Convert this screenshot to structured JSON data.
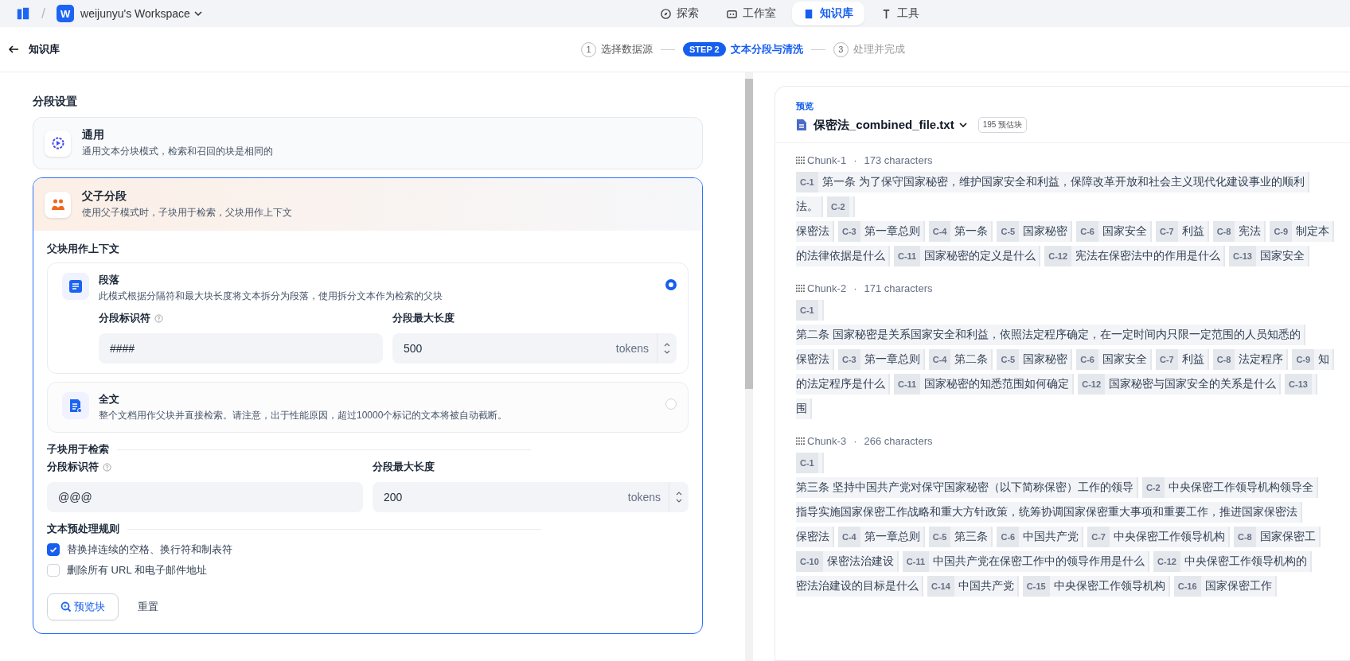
{
  "nav": {
    "separator": "/",
    "workspace": {
      "initial": "W",
      "name": "weijunyu's Workspace"
    },
    "tabs": [
      {
        "label": "探索",
        "kind": "explore",
        "selected": false
      },
      {
        "label": "工作室",
        "kind": "studio",
        "selected": false
      },
      {
        "label": "知识库",
        "kind": "knowledge",
        "selected": true
      },
      {
        "label": "工具",
        "kind": "tools",
        "selected": false
      }
    ]
  },
  "header": {
    "back_label": "知识库",
    "steps": [
      {
        "badge": "1",
        "label": "选择数据源",
        "selected": false
      },
      {
        "badge": "STEP 2",
        "label": "文本分段与清洗",
        "selected": true
      },
      {
        "badge": "3",
        "label": "处理并完成",
        "selected": false
      }
    ]
  },
  "settings": {
    "title": "分段设置",
    "modes": [
      {
        "kind": "general",
        "title": "通用",
        "description": "通用文本分块模式，检索和召回的块是相同的",
        "selected": false
      },
      {
        "kind": "parent_child",
        "title": "父子分段",
        "description": "使用父子模式时，子块用于检索，父块用作上下文",
        "selected": true
      }
    ],
    "parent": {
      "title": "父块用作上下文",
      "options": [
        {
          "kind": "paragraph",
          "title": "段落",
          "description": "此模式根据分隔符和最大块长度将文本拆分为段落，使用拆分文本作为检索的父块",
          "selected": true,
          "fields": [
            {
              "kind": "delimiter",
              "label": "分段标识符",
              "value": "####"
            },
            {
              "kind": "max_length",
              "label": "分段最大长度",
              "value": "500",
              "unit": "tokens"
            }
          ]
        },
        {
          "kind": "fulltext",
          "title": "全文",
          "description": "整个文档用作父块并直接检索。请注意，出于性能原因，超过10000个标记的文本将被自动截断。",
          "selected": false
        }
      ]
    },
    "child": {
      "title": "子块用于检索",
      "fields": [
        {
          "kind": "delimiter",
          "label": "分段标识符",
          "value": "@@@"
        },
        {
          "kind": "max_length",
          "label": "分段最大长度",
          "value": "200",
          "unit": "tokens"
        }
      ]
    },
    "preprocessing": {
      "title": "文本预处理规则",
      "rules": [
        {
          "label": "替换掉连续的空格、换行符和制表符",
          "checked": true
        },
        {
          "label": "删除所有 URL 和电子邮件地址",
          "checked": false
        }
      ]
    },
    "buttons": {
      "preview": "预览块",
      "reset": "重置"
    }
  },
  "preview": {
    "label": "预览",
    "file": "保密法_combined_file.txt",
    "count": "195 预估块",
    "chunks": [
      {
        "title": "Chunk-1",
        "separator": "·",
        "meta": "173 characters",
        "lines": [
          [
            {
              "tag": "C-1",
              "text": "第一条 为了保守国家秘密，维护国家安全和利益，保障改革开放和社会主义现代化建设事业的顺利"
            }
          ],
          [
            {
              "text": "法。"
            },
            {
              "tag": "C-2"
            }
          ],
          [
            {
              "text": "保密法"
            },
            {
              "tag": "C-3",
              "text": "第一章总则"
            },
            {
              "tag": "C-4",
              "text": "第一条"
            },
            {
              "tag": "C-5",
              "text": "国家秘密"
            },
            {
              "tag": "C-6",
              "text": "国家安全"
            },
            {
              "tag": "C-7",
              "text": "利益"
            },
            {
              "tag": "C-8",
              "text": "宪法"
            },
            {
              "tag": "C-9",
              "text": "制定本"
            }
          ],
          [
            {
              "text": "的法律依据是什么"
            },
            {
              "tag": "C-11",
              "text": "国家秘密的定义是什么"
            },
            {
              "tag": "C-12",
              "text": "宪法在保密法中的作用是什么"
            },
            {
              "tag": "C-13",
              "text": "国家安全"
            }
          ]
        ]
      },
      {
        "title": "Chunk-2",
        "separator": "·",
        "meta": "171 characters",
        "lines": [
          [
            {
              "tag": "C-1"
            }
          ],
          [
            {
              "text": "第二条 国家秘密是关系国家安全和利益，依照法定程序确定，在一定时间内只限一定范围的人员知悉的"
            }
          ],
          [
            {
              "text": "保密法"
            },
            {
              "tag": "C-3",
              "text": "第一章总则"
            },
            {
              "tag": "C-4",
              "text": "第二条"
            },
            {
              "tag": "C-5",
              "text": "国家秘密"
            },
            {
              "tag": "C-6",
              "text": "国家安全"
            },
            {
              "tag": "C-7",
              "text": "利益"
            },
            {
              "tag": "C-8",
              "text": "法定程序"
            },
            {
              "tag": "C-9",
              "text": "知"
            }
          ],
          [
            {
              "text": "的法定程序是什么"
            },
            {
              "tag": "C-11",
              "text": "国家秘密的知悉范围如何确定"
            },
            {
              "tag": "C-12",
              "text": "国家秘密与国家安全的关系是什么"
            },
            {
              "tag": "C-13"
            }
          ],
          [
            {
              "text": "围"
            }
          ]
        ]
      },
      {
        "title": "Chunk-3",
        "separator": "·",
        "meta": "266 characters",
        "lines": [
          [
            {
              "tag": "C-1"
            }
          ],
          [
            {
              "text": "第三条 坚持中国共产党对保守国家秘密（以下简称保密）工作的领导"
            },
            {
              "tag": "C-2",
              "text": "中央保密工作领导机构领导全"
            }
          ],
          [
            {
              "text": "指导实施国家保密工作战略和重大方针政策，统筹协调国家保密重大事项和重要工作，推进国家保密法"
            }
          ],
          [
            {
              "text": "保密法"
            },
            {
              "tag": "C-4",
              "text": "第一章总则"
            },
            {
              "tag": "C-5",
              "text": "第三条"
            },
            {
              "tag": "C-6",
              "text": "中国共产党"
            },
            {
              "tag": "C-7",
              "text": "中央保密工作领导机构"
            },
            {
              "tag": "C-8",
              "text": "国家保密工"
            }
          ],
          [
            {
              "tag": "C-10",
              "text": "保密法治建设"
            },
            {
              "tag": "C-11",
              "text": "中国共产党在保密工作中的领导作用是什么"
            },
            {
              "tag": "C-12",
              "text": "中央保密工作领导机构的"
            }
          ],
          [
            {
              "text": "密法治建设的目标是什么"
            },
            {
              "tag": "C-14",
              "text": "中国共产党"
            },
            {
              "tag": "C-15",
              "text": "中央保密工作领导机构"
            },
            {
              "tag": "C-16",
              "text": "国家保密工作"
            }
          ]
        ]
      }
    ]
  }
}
